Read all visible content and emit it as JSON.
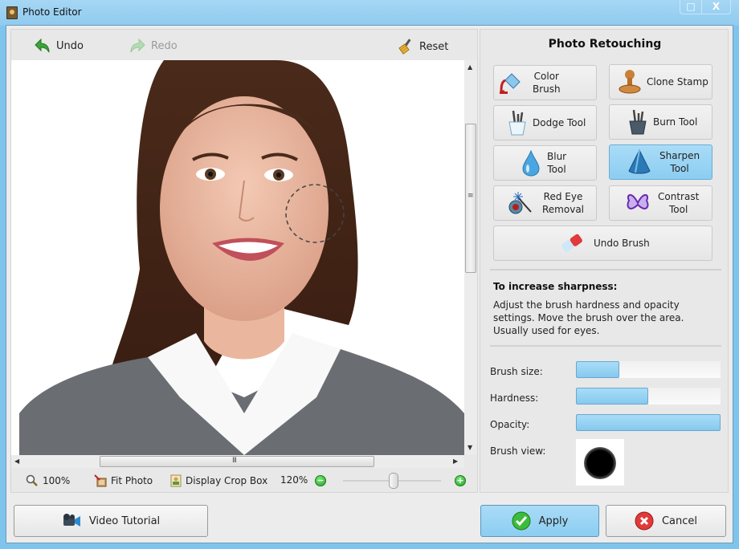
{
  "window": {
    "title": "Photo Editor",
    "maximize_glyph": "□",
    "close_glyph": "X"
  },
  "toolbar": {
    "undo_label": "Undo",
    "redo_label": "Redo",
    "reset_label": "Reset",
    "redo_enabled": false
  },
  "statusbar": {
    "zoom_actual_label": "100%",
    "fit_photo_label": "Fit Photo",
    "display_crop_box_label": "Display Crop Box",
    "zoom_level": "120%",
    "zoom_out_glyph": "−",
    "zoom_in_glyph": "+"
  },
  "retouch": {
    "title": "Photo Retouching",
    "tools": [
      {
        "id": "color-brush",
        "label1": "Color",
        "label2": "Brush",
        "active": false
      },
      {
        "id": "clone-stamp",
        "label1": "Clone Stamp",
        "label2": "",
        "active": false
      },
      {
        "id": "dodge-tool",
        "label1": "Dodge Tool",
        "label2": "",
        "active": false
      },
      {
        "id": "burn-tool",
        "label1": "Burn Tool",
        "label2": "",
        "active": false
      },
      {
        "id": "blur-tool",
        "label1": "Blur",
        "label2": "Tool",
        "active": false
      },
      {
        "id": "sharpen-tool",
        "label1": "Sharpen",
        "label2": "Tool",
        "active": true
      },
      {
        "id": "red-eye-removal",
        "label1": "Red Eye",
        "label2": "Removal",
        "active": false
      },
      {
        "id": "contrast-tool",
        "label1": "Contrast",
        "label2": "Tool",
        "active": false
      },
      {
        "id": "undo-brush",
        "label1": "Undo Brush",
        "label2": "",
        "active": false
      }
    ],
    "hint_title": "To increase sharpness:",
    "hint_text": "Adjust the brush hardness and opacity settings. Move the brush over the area. Usually used for eyes.",
    "brush_size_label": "Brush size:",
    "hardness_label": "Hardness:",
    "opacity_label": "Opacity:",
    "brush_view_label": "Brush view:",
    "brush_size_fraction": 0.3,
    "hardness_fraction": 0.5,
    "opacity_fraction": 1.0
  },
  "buttons": {
    "video_tutorial": "Video Tutorial",
    "apply": "Apply",
    "cancel": "Cancel"
  },
  "colors": {
    "accent": "#8ccdf1",
    "title_bar": "#8fcbef",
    "panel": "#e8e8e8"
  }
}
